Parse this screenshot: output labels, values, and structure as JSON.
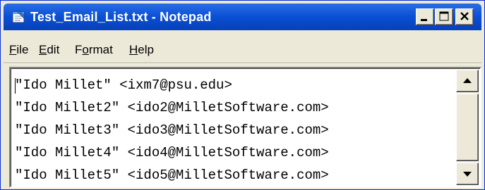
{
  "window": {
    "title": "Test_Email_List.txt - Notepad",
    "controls": {
      "minimize": "minimize",
      "maximize": "maximize",
      "close": "close"
    }
  },
  "menu": [
    {
      "underline": "F",
      "rest": "ile"
    },
    {
      "underline": "E",
      "rest": "dit"
    },
    {
      "pre": "F",
      "underline": "o",
      "rest": "rmat"
    },
    {
      "underline": "H",
      "rest": "elp"
    }
  ],
  "document": {
    "lines": [
      "\"Ido Millet\" <ixm7@psu.edu>",
      "\"Ido Millet2\" <ido2@MilletSoftware.com>",
      "\"Ido Millet3\" <ido3@MilletSoftware.com>",
      "\"Ido Millet4\" <ido4@MilletSoftware.com>",
      "\"Ido Millet5\" <ido5@MilletSoftware.com>"
    ]
  },
  "icons": {
    "app": "notepad-icon",
    "scroll_up": "arrow-up-icon",
    "scroll_down": "arrow-down-icon"
  },
  "colors": {
    "title_bar": "#0a4fd4",
    "window_face": "#ece9d8",
    "editor_bg": "#ffffff"
  }
}
